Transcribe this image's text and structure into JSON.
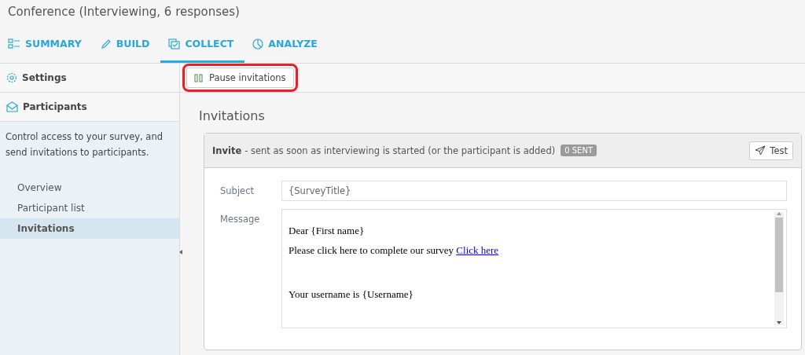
{
  "title": "Conference (Interviewing, 6 responses)",
  "tabs": [
    {
      "label": "SUMMARY",
      "selected": false
    },
    {
      "label": "BUILD",
      "selected": false
    },
    {
      "label": "COLLECT",
      "selected": true
    },
    {
      "label": "ANALYZE",
      "selected": false
    }
  ],
  "sidebar": {
    "sections": [
      {
        "label": "Settings"
      },
      {
        "label": "Participants"
      }
    ],
    "description": "Control access to your survey, and send invitations to participants.",
    "items": [
      {
        "label": "Overview",
        "selected": false
      },
      {
        "label": "Participant list",
        "selected": false
      },
      {
        "label": "Invitations",
        "selected": true
      }
    ]
  },
  "toolbar": {
    "button": {
      "label": "Pause invitations",
      "highlighted": true
    }
  },
  "heading": "Invitations",
  "card": {
    "name": "Invite",
    "description": "- sent as soon as interviewing is started (or the participant is added)",
    "badge": "0 SENT",
    "test_button": "Test",
    "subject_label": "Subject",
    "subject": "{SurveyTitle}",
    "message_label": "Message",
    "message": [
      {
        "text": "Dear {First name}"
      },
      {
        "text": "Please click here to complete our survey",
        "link": "Click here"
      },
      {
        "text": "Your username is {Username}"
      }
    ]
  }
}
